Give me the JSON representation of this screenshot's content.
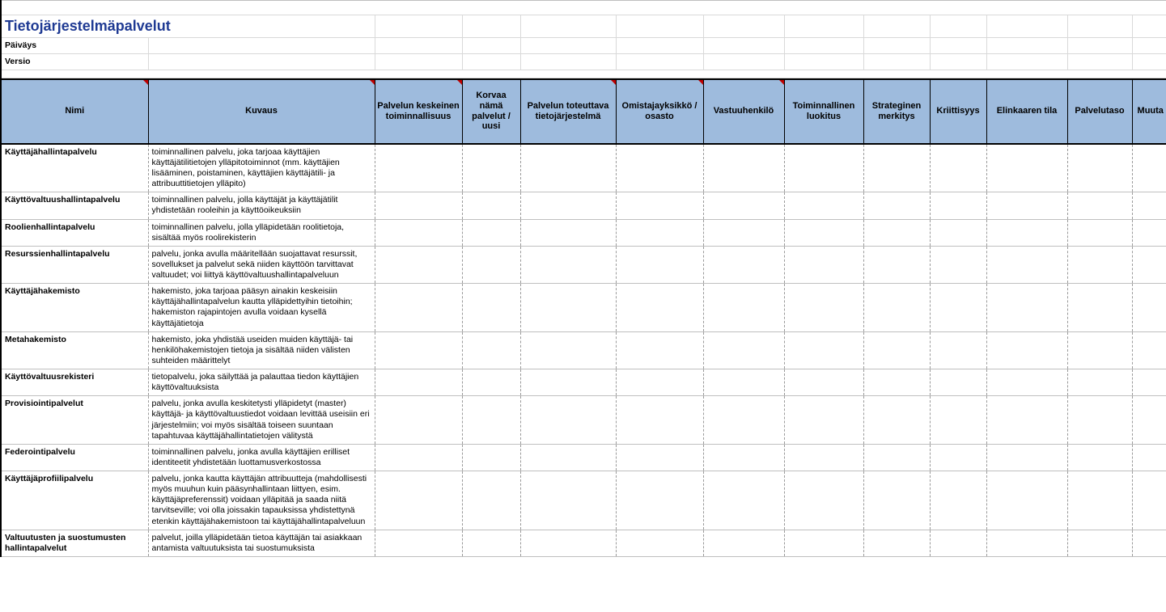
{
  "meta": {
    "title": "Tietojärjestelmäpalvelut",
    "date_label": "Päiväys",
    "version_label": "Versio"
  },
  "headers": [
    "Nimi",
    "Kuvaus",
    "Palvelun keskeinen toiminnallisuus",
    "Korvaa nämä palvelut / uusi",
    "Palvelun toteuttava tietojärjestelmä",
    "Omistajayksikkö / osasto",
    "Vastuuhenkilö",
    "Toiminnallinen luokitus",
    "Strateginen merkitys",
    "Kriittisyys",
    "Elinkaaren tila",
    "Palvelutaso",
    "Muuta"
  ],
  "header_triangles": [
    true,
    true,
    true,
    false,
    true,
    true,
    true,
    false,
    false,
    false,
    false,
    false,
    false
  ],
  "rows": [
    {
      "name": "Käyttäjähallintapalvelu",
      "desc": "toiminnallinen palvelu, joka tarjoaa käyttäjien käyttäjätilitietojen ylläpitotoiminnot (mm. käyttäjien lisääminen, poistaminen, käyttäjien käyttäjätili- ja attribuuttitietojen ylläpito)"
    },
    {
      "name": "Käyttövaltuushallintapalvelu",
      "desc": "toiminnallinen palvelu, jolla käyttäjät ja käyttäjätilit yhdistetään rooleihin ja käyttöoikeuksiin"
    },
    {
      "name": "Roolienhallintapalvelu",
      "desc": "toiminnallinen palvelu, jolla ylläpidetään roolitietoja, sisältää myös roolirekisterin"
    },
    {
      "name": "Resurssienhallintapalvelu",
      "desc": "palvelu, jonka avulla määritellään suojattavat resurssit, sovellukset ja palvelut sekä niiden käyttöön tarvittavat valtuudet; voi liittyä käyttövaltuushallintapalveluun"
    },
    {
      "name": "Käyttäjähakemisto",
      "desc": "hakemisto, joka tarjoaa pääsyn ainakin keskeisiin käyttäjähallintapalvelun kautta ylläpidettyihin tietoihin; hakemiston rajapintojen avulla voidaan kysellä käyttäjätietoja"
    },
    {
      "name": "Metahakemisto",
      "desc": "hakemisto, joka yhdistää useiden muiden käyttäjä- tai henkilöhakemistojen tietoja ja sisältää niiden välisten suhteiden määrittelyt"
    },
    {
      "name": "Käyttövaltuusrekisteri",
      "desc": "tietopalvelu, joka säilyttää ja palauttaa tiedon käyttäjien käyttövaltuuksista"
    },
    {
      "name": "Provisiointipalvelut",
      "desc": "palvelu, jonka avulla keskitetysti ylläpidetyt (master) käyttäjä- ja käyttövaltuustiedot voidaan levittää useisiin eri järjestelmiin; voi myös sisältää toiseen suuntaan tapahtuvaa käyttäjähallintatietojen välitystä"
    },
    {
      "name": "Federointipalvelu",
      "desc": "toiminnallinen palvelu, jonka avulla käyttäjien erilliset identiteetit yhdistetään luottamusverkostossa"
    },
    {
      "name": "Käyttäjäprofiilipalvelu",
      "desc": "palvelu, jonka kautta käyttäjän attribuutteja (mahdollisesti myös muuhun kuin pääsynhallintaan liittyen, esim. käyttäjäpreferenssit) voidaan ylläpitää ja saada niitä tarvitseville; voi olla joissakin tapauksissa yhdistettynä etenkin käyttäjähakemistoon tai käyttäjähallintapalveluun"
    },
    {
      "name": "Valtuutusten ja suostumusten hallintapalvelut",
      "desc": "palvelut, joilla ylläpidetään tietoa käyttäjän tai asiakkaan antamista valtuutuksista tai suostumuksista"
    }
  ]
}
